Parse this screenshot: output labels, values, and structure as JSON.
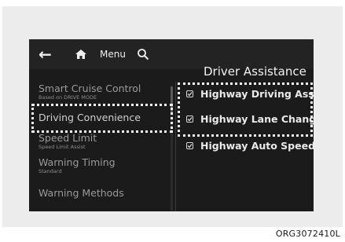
{
  "topbar": {
    "back_icon": "back-arrow-icon",
    "home_icon": "home-icon",
    "menu_label": "Menu",
    "search_icon": "search-icon"
  },
  "title": "Driver Assistance",
  "left_menu": [
    {
      "label": "Smart Cruise Control",
      "sub": "Based on DRIVE MODE"
    },
    {
      "label": "Driving Convenience",
      "sub": ""
    },
    {
      "label": "Speed Limit",
      "sub": "Speed Limit Assist"
    },
    {
      "label": "Warning Timing",
      "sub": "Standard"
    },
    {
      "label": "Warning Methods",
      "sub": ""
    }
  ],
  "right_options": [
    {
      "label": "Highway Driving Assist",
      "checked": true
    },
    {
      "label": "Highway Lane Change...",
      "checked": true
    },
    {
      "label": "Highway Auto Speed...",
      "checked": true
    }
  ],
  "caption": "ORG3072410L",
  "colors": {
    "screen_bg": "#1b1b1b",
    "frame_bg": "#ececec",
    "highlight": "#f4f4f4"
  }
}
